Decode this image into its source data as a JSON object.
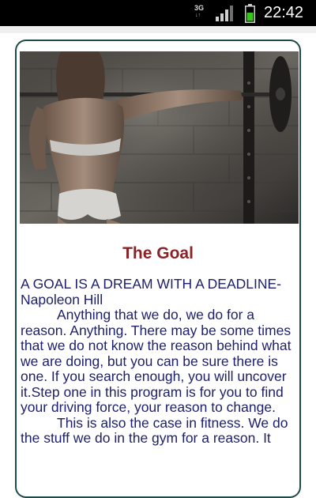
{
  "status_bar": {
    "network_type": "3G",
    "network_arrows": "↓↑",
    "time": "22:42",
    "icons": [
      "network-3g-icon",
      "signal-strength-icon",
      "battery-icon"
    ],
    "colors": {
      "background": "#000000",
      "battery": "#35c51c"
    }
  },
  "article": {
    "hero_image": "woman-fitness-back-barbell-photo",
    "title": "The Goal",
    "quote": "A GOAL IS A DREAM WITH A DEADLINE-Napoleon Hill",
    "paragraphs": [
      "Anything that we do, we do for a reason. Anything. There may be some times that we do not know the reason behind what we are doing, but you can be sure there is one. If you search enough, you will uncover it.Step one in this program is for you to find your driving force, your reason to change.",
      "This is also the case in fitness. We do the stuff we do in the gym for a reason. It"
    ],
    "colors": {
      "title": "#8a2328",
      "body_text": "#1d1f6a",
      "card_border": "#1e4a4b"
    }
  }
}
